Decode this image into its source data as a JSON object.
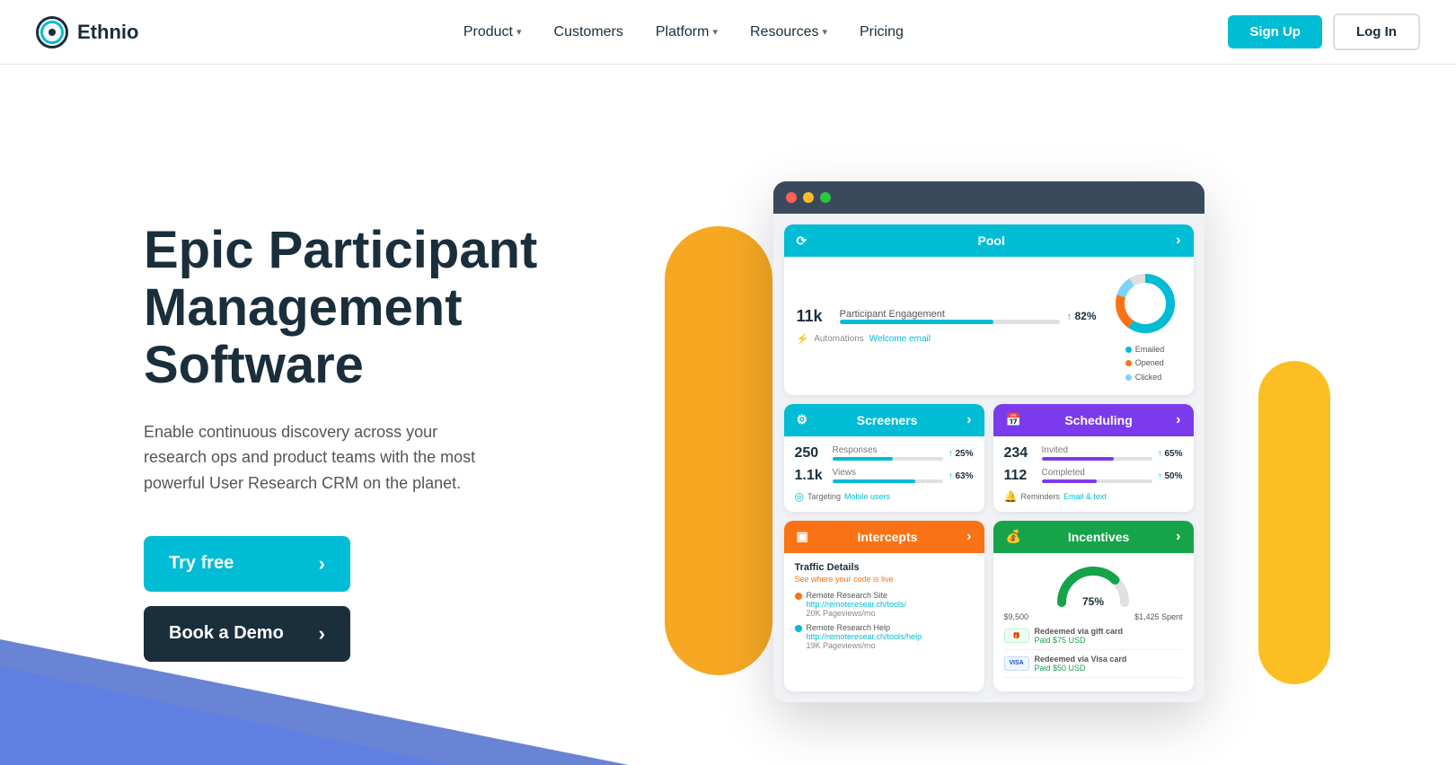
{
  "brand": {
    "name": "Ethnio",
    "logo_alt": "Ethnio logo"
  },
  "nav": {
    "links": [
      {
        "label": "Product",
        "has_dropdown": true
      },
      {
        "label": "Customers",
        "has_dropdown": false
      },
      {
        "label": "Platform",
        "has_dropdown": true
      },
      {
        "label": "Resources",
        "has_dropdown": true
      },
      {
        "label": "Pricing",
        "has_dropdown": false
      }
    ],
    "signup_label": "Sign Up",
    "login_label": "Log In"
  },
  "hero": {
    "title": "Epic Participant Management Software",
    "subtitle": "Enable continuous discovery across your research ops and product teams with the most powerful User Research CRM on the planet.",
    "try_free_label": "Try free",
    "book_demo_label": "Book a Demo"
  },
  "dashboard": {
    "pool": {
      "header": "Pool",
      "participants_count": "11k",
      "participants_label": "Participant Engagement",
      "participants_pct": "↑ 82%",
      "bar_pct": 70,
      "automations_label": "Automations",
      "automations_link": "Welcome email",
      "legend": [
        {
          "label": "Emailed",
          "color": "#00bcd4"
        },
        {
          "label": "Opened",
          "color": "#f97316"
        },
        {
          "label": "Clicked",
          "color": "#7dd3fc"
        }
      ]
    },
    "screeners": {
      "header": "Screeners",
      "responses_count": "250",
      "responses_label": "Responses",
      "responses_pct": "↑ 25%",
      "responses_bar": 55,
      "views_count": "1.1k",
      "views_label": "Views",
      "views_pct": "↑ 63%",
      "views_bar": 75,
      "targeting_label": "Targeting",
      "targeting_link": "Mobile users"
    },
    "scheduling": {
      "header": "Scheduling",
      "invited_count": "234",
      "invited_label": "Invited",
      "invited_pct": "↑ 65%",
      "invited_bar": 65,
      "completed_count": "112",
      "completed_label": "Completed",
      "completed_pct": "↑ 50%",
      "completed_bar": 50,
      "reminders_label": "Reminders",
      "reminders_link": "Email & text"
    },
    "intercepts": {
      "header": "Intercepts",
      "traffic_title": "Traffic Details",
      "traffic_sub": "See where your code is live",
      "sites": [
        {
          "label": "Remote Research Site",
          "link": "http://remoteresear.ch/tools/",
          "views": "20K Pageviews/mo",
          "color": "#f97316"
        },
        {
          "label": "Remote Research Help",
          "link": "http://remoteresear.ch/tools/help",
          "views": "19K Pageviews/mo",
          "color": "#00bcd4"
        }
      ]
    },
    "incentives": {
      "header": "Incentives",
      "gauge_pct": "75%",
      "total": "$9,500",
      "spent": "$1,425 Spent",
      "rows": [
        {
          "type": "gift",
          "label": "Redeemed via gift card",
          "sub": "Paid $75 USD"
        },
        {
          "type": "visa",
          "label": "Redeemed via Visa card",
          "sub": "Paid $50 USD"
        }
      ]
    }
  }
}
